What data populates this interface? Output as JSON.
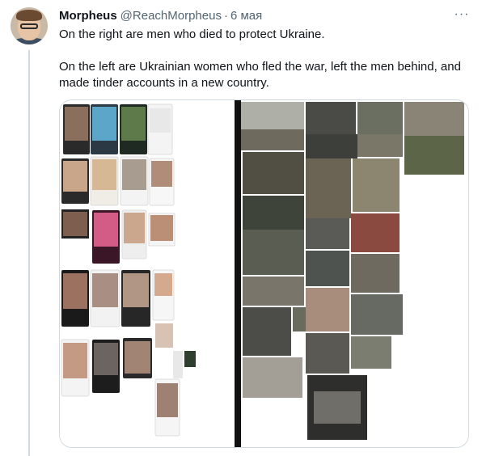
{
  "tweet": {
    "display_name": "Morpheus",
    "handle": "@ReachMorpheus",
    "separator": "·",
    "time": "6 мая",
    "more_label": "···",
    "paragraphs": [
      "On the right are men who died to protect Ukraine.",
      "On the left are Ukrainian women who fled the war, left the men behind, and made tinder accounts in a new country."
    ]
  },
  "media": {
    "left_panel": "collage of dating-app profile screenshots",
    "right_panel": "collage of war photographs"
  },
  "colors": {
    "text_primary": "#0f1419",
    "text_secondary": "#536471",
    "border": "#cfd9de",
    "thread_line": "#cfd9de"
  },
  "icons": [
    "more-options-icon"
  ]
}
